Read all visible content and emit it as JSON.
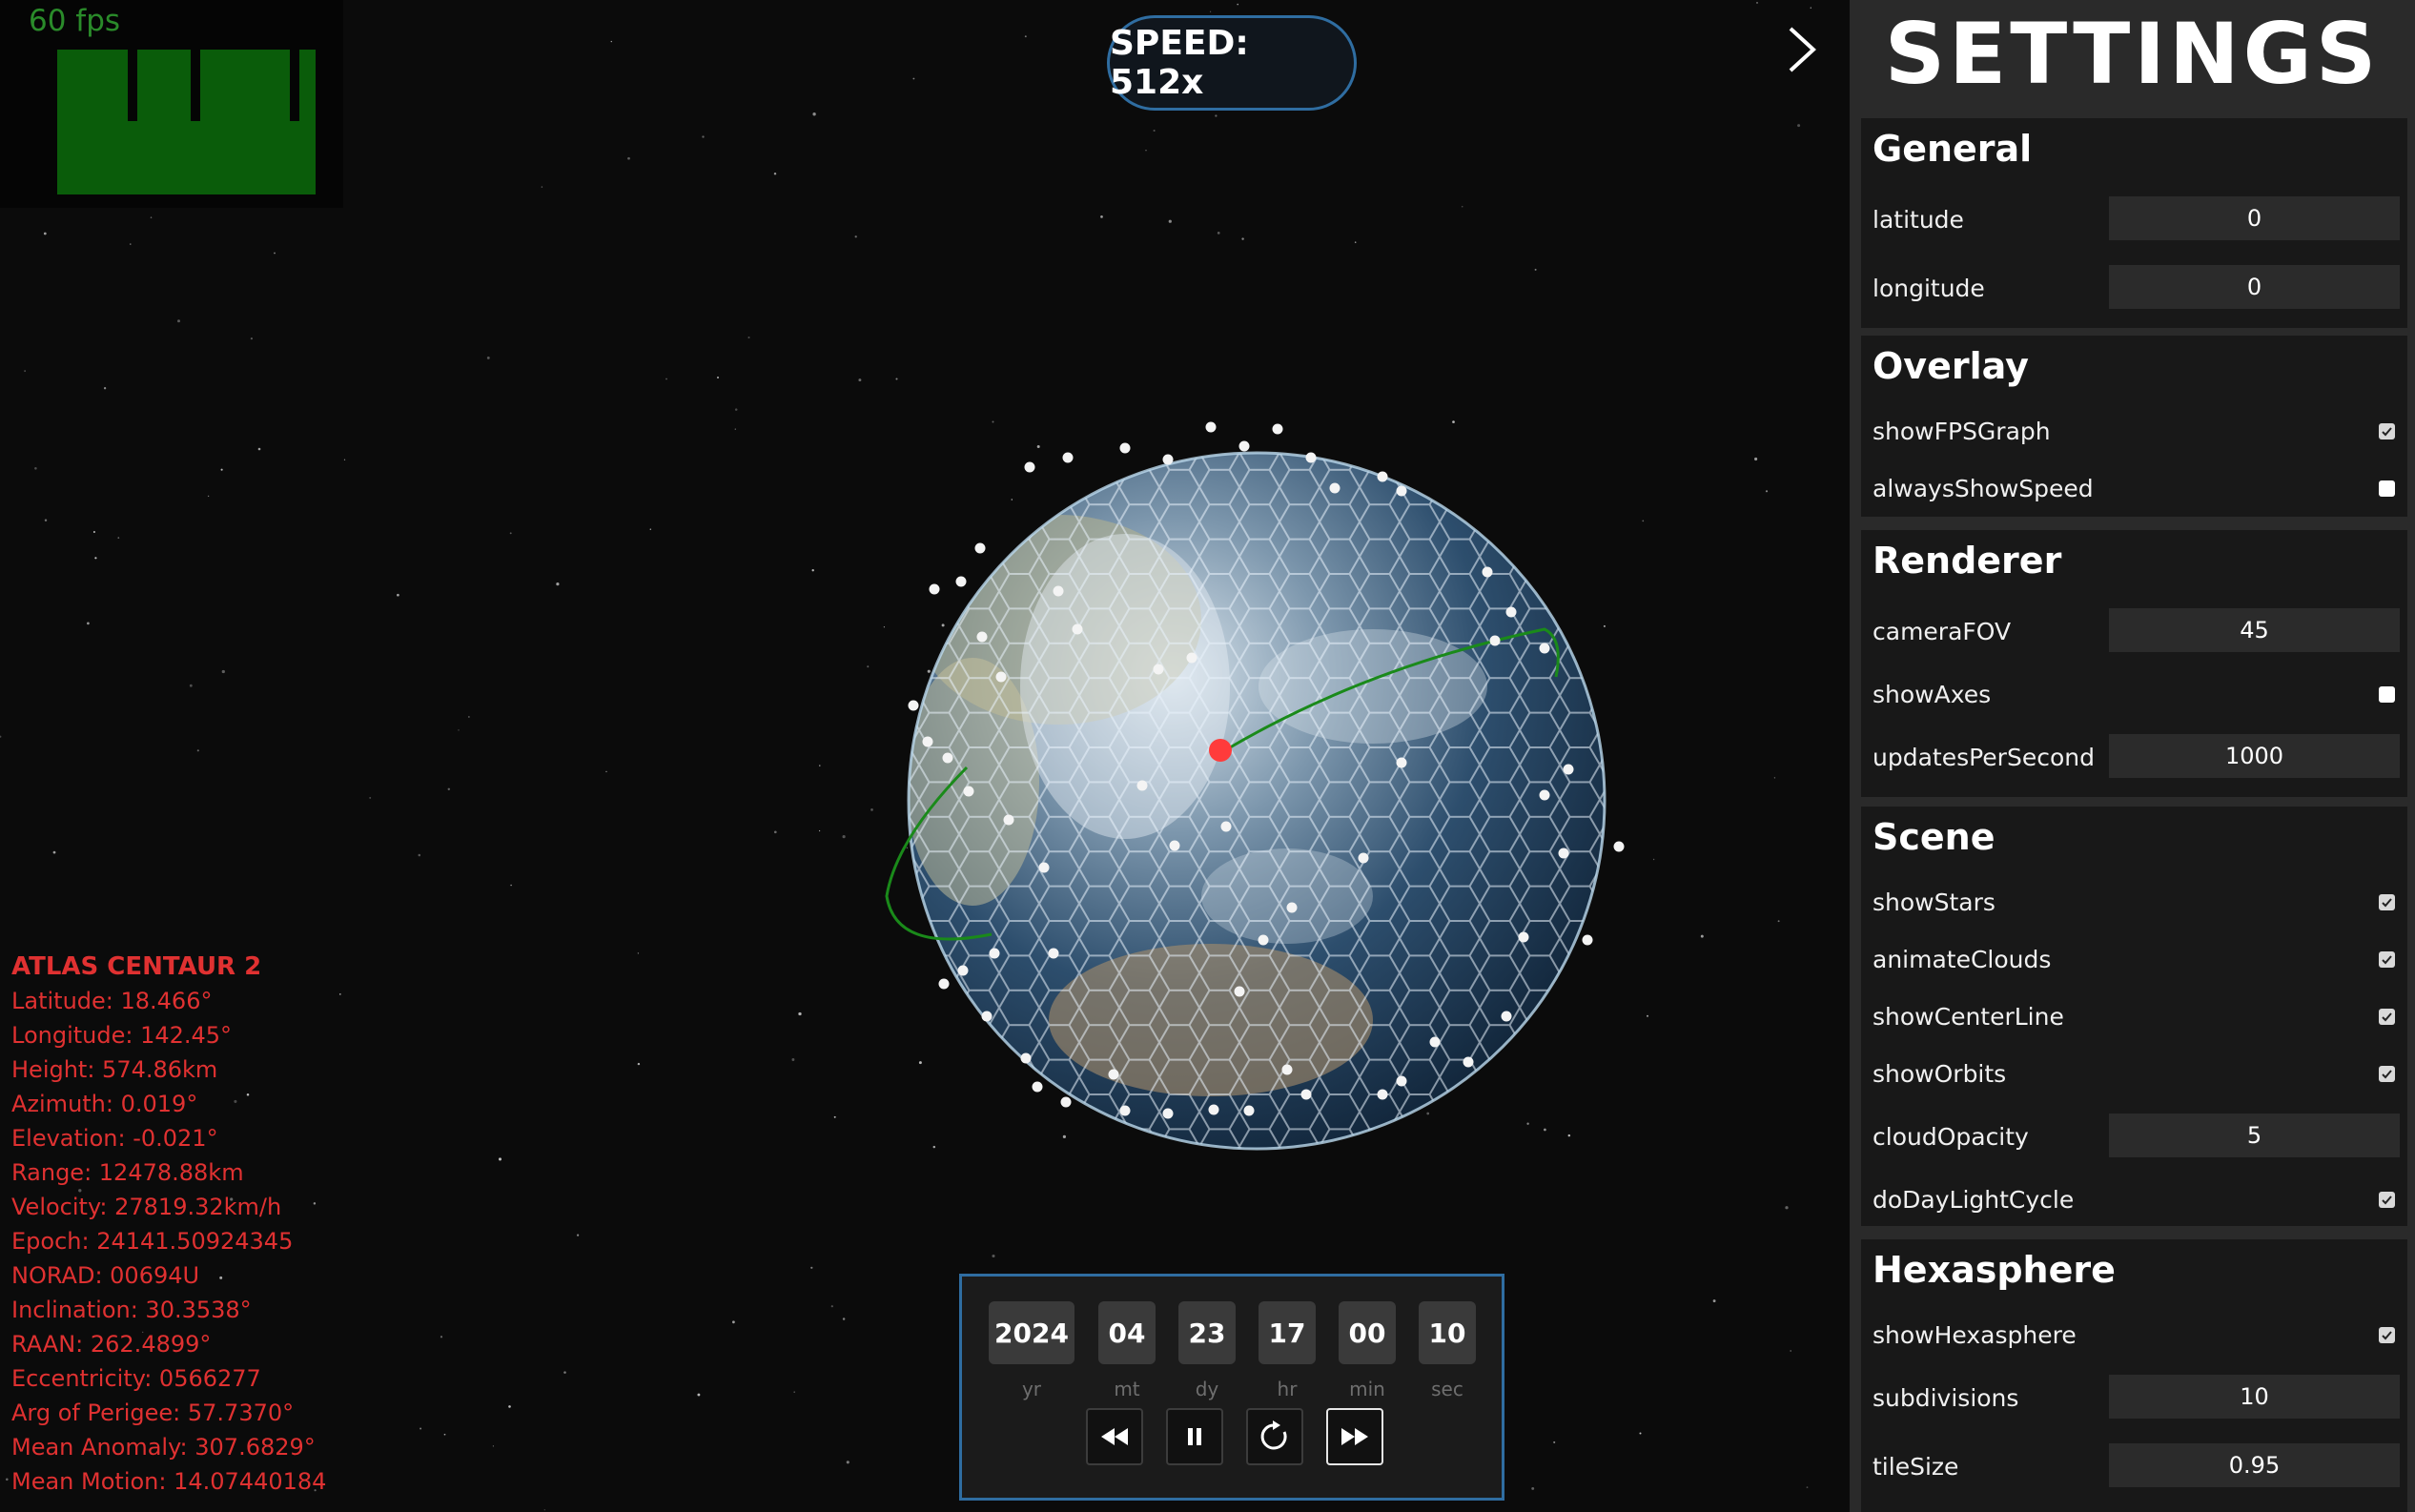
{
  "fps": {
    "label": "60 fps"
  },
  "speed": {
    "label": "SPEED: 512x"
  },
  "satellite": {
    "name": "ATLAS CENTAUR 2",
    "latitude": "Latitude: 18.466°",
    "longitude": "Longitude: 142.45°",
    "height": "Height: 574.86km",
    "azimuth": "Azimuth: 0.019°",
    "elevation": "Elevation: -0.021°",
    "range": "Range: 12478.88km",
    "velocity": "Velocity: 27819.32km/h",
    "epoch": "Epoch: 24141.50924345",
    "norad": "NORAD: 00694U",
    "inclination": "Inclination: 30.3538°",
    "raan": "RAAN: 262.4899°",
    "eccentricity": "Eccentricity: 0566277",
    "arg_perigee": "Arg of Perigee: 57.7370°",
    "mean_anomaly": "Mean Anomaly: 307.6829°",
    "mean_motion": "Mean Motion: 14.07440184"
  },
  "time": {
    "year": "2024",
    "month": "04",
    "day": "23",
    "hour": "17",
    "minute": "00",
    "second": "10",
    "labels": {
      "yr": "yr",
      "mt": "mt",
      "dy": "dy",
      "hr": "hr",
      "min": "min",
      "sec": "sec"
    }
  },
  "settings": {
    "title": "SETTINGS",
    "general": {
      "title": "General",
      "latitude_label": "latitude",
      "latitude_value": "0",
      "longitude_label": "longitude",
      "longitude_value": "0"
    },
    "overlay": {
      "title": "Overlay",
      "showFPSGraph": "showFPSGraph",
      "showFPSGraph_checked": true,
      "alwaysShowSpeed": "alwaysShowSpeed",
      "alwaysShowSpeed_checked": false
    },
    "renderer": {
      "title": "Renderer",
      "cameraFOV_label": "cameraFOV",
      "cameraFOV_value": "45",
      "showAxes": "showAxes",
      "showAxes_checked": false,
      "updatesPerSecond_label": "updatesPerSecond",
      "updatesPerSecond_value": "1000"
    },
    "scene": {
      "title": "Scene",
      "showStars": "showStars",
      "showStars_checked": true,
      "animateClouds": "animateClouds",
      "animateClouds_checked": true,
      "showCenterLine": "showCenterLine",
      "showCenterLine_checked": true,
      "showOrbits": "showOrbits",
      "showOrbits_checked": true,
      "cloudOpacity_label": "cloudOpacity",
      "cloudOpacity_value": "5",
      "doDayLightCycle": "doDayLightCycle",
      "doDayLightCycle_checked": true
    },
    "hexasphere": {
      "title": "Hexasphere",
      "showHexasphere": "showHexasphere",
      "showHexasphere_checked": true,
      "subdivisions_label": "subdivisions",
      "subdivisions_value": "10",
      "tileSize_label": "tileSize",
      "tileSize_value": "0.95"
    }
  },
  "colors": {
    "accent_border": "#2f6da1",
    "info_text": "#e03131",
    "fps_graph": "#0a5c0a",
    "orbit": "#1a8a1a",
    "selected_satellite": "#ff3b3b"
  },
  "icons": {
    "collapse": "chevron-right-icon",
    "rewind": "rewind-icon",
    "pause": "pause-icon",
    "reset": "reset-icon",
    "fast_forward": "fast-forward-icon"
  }
}
